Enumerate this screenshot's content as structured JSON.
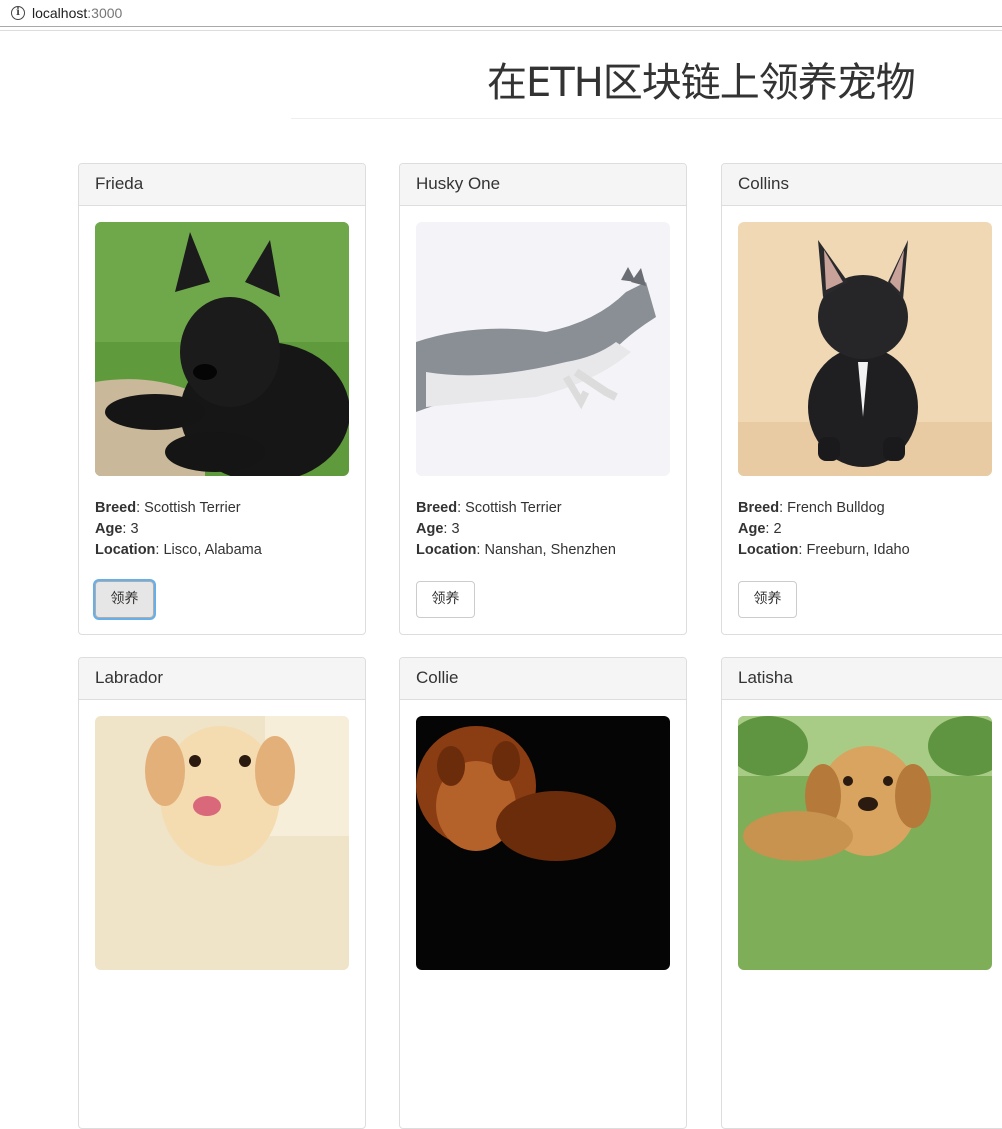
{
  "browser": {
    "url_host": "localhost",
    "url_port": ":3000"
  },
  "page": {
    "title": "在ETH区块链上领养宠物"
  },
  "labels": {
    "breed": "Breed",
    "age": "Age",
    "location": "Location",
    "adopt_button": "领养"
  },
  "pets": [
    {
      "name": "Frieda",
      "breed": "Scottish Terrier",
      "age": "3",
      "location": "Lisco, Alabama",
      "image": "black-scottish-terrier-on-grass"
    },
    {
      "name": "Husky One",
      "breed": "Scottish Terrier",
      "age": "3",
      "location": "Nanshan, Shenzhen",
      "image": "leaping-husky-on-white"
    },
    {
      "name": "Collins",
      "breed": "French Bulldog",
      "age": "2",
      "location": "Freeburn, Idaho",
      "image": "black-french-bulldog-on-beige"
    },
    {
      "name": "Labrador",
      "image": "yellow-labrador-indoors"
    },
    {
      "name": "Collie",
      "image": "collie-on-black"
    },
    {
      "name": "Latisha",
      "image": "golden-retriever-in-garden"
    }
  ],
  "colors": {
    "header_bg": "#f5f5f5",
    "border": "#dddddd",
    "focus_ring": "#66afe9"
  }
}
